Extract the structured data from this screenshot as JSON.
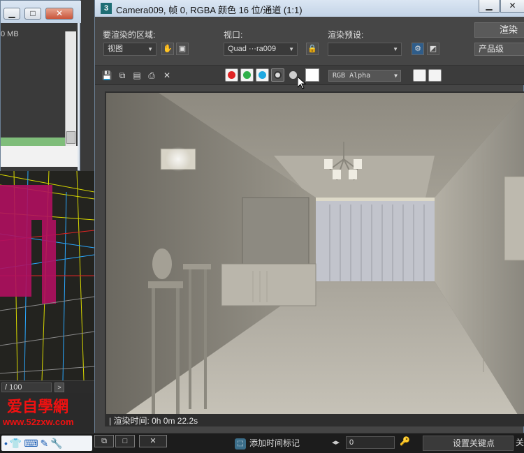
{
  "background": {
    "left_window": {
      "min_label": "▁",
      "max_label": "□",
      "close_label": "✕",
      "memory_text": "0 MB"
    },
    "timeline": {
      "frame_text": "/ 100",
      "next_label": ">"
    },
    "watermark": {
      "brand": "爱自學網",
      "url": "www.52zxw.com"
    }
  },
  "render_window": {
    "title": "Camera009, 帧 0, RGBA 颜色 16 位/通道 (1:1)",
    "app_icon_label": "3",
    "min_label": "▁",
    "close_label": "✕",
    "area_label": "要渲染的区域:",
    "area_value": "视图",
    "viewport_label": "视口:",
    "viewport_value": "Quad ···ra009",
    "preset_label": "渲染预设:",
    "preset_value": "",
    "render_button": "渲染",
    "quality_value": "产品级",
    "channel_value": "RGB Alpha",
    "status_text": "| 渲染时间: 0h 0m 22.2s",
    "icon_labels": {
      "pan": "✋",
      "region": "▣",
      "lock": "🔒",
      "settings": "⚙",
      "env": "◩",
      "save": "💾",
      "copy": "⧉",
      "clone": "▤",
      "print": "⎙",
      "clear": "✕",
      "chevron": "▼"
    }
  },
  "taskbar": {
    "icons_text": "•👕⌨✎🔧",
    "win_restore": "⧉",
    "win_max": "□",
    "win_close": "✕",
    "key_filter_icon": "⬚",
    "key_filter": "添加时间标记",
    "frame_arrows": "◂▸",
    "frame_value": "0",
    "lock_icon": "🔑",
    "set_key": "设置关键点",
    "extra": "关"
  },
  "colors": {
    "accent_red": "#e02424",
    "accent_green": "#2fb04a",
    "accent_blue": "#1ea8e0"
  }
}
